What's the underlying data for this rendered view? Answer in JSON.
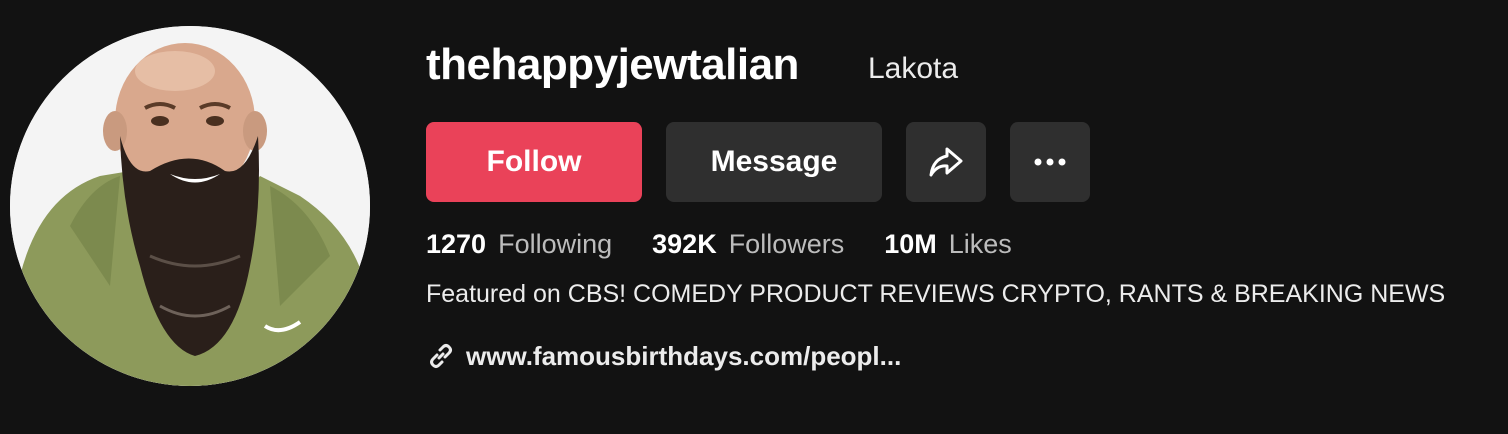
{
  "profile": {
    "username": "thehappyjewtalian",
    "nickname": "Lakota",
    "avatar_alt": "avatar"
  },
  "actions": {
    "follow_label": "Follow",
    "message_label": "Message",
    "share_icon": "share-arrow-icon",
    "more_icon": "more-dots-icon"
  },
  "stats": {
    "following_count": "1270",
    "following_label": "Following",
    "followers_count": "392K",
    "followers_label": "Followers",
    "likes_count": "10M",
    "likes_label": "Likes"
  },
  "bio": "Featured on CBS! COMEDY PRODUCT REVIEWS CRYPTO, RANTS & BREAKING NEWS",
  "link": {
    "icon": "link-icon",
    "text": "www.famousbirthdays.com/peopl..."
  },
  "colors": {
    "background": "#121212",
    "follow_button": "#ea4259",
    "secondary_button": "#2f2f2f"
  }
}
